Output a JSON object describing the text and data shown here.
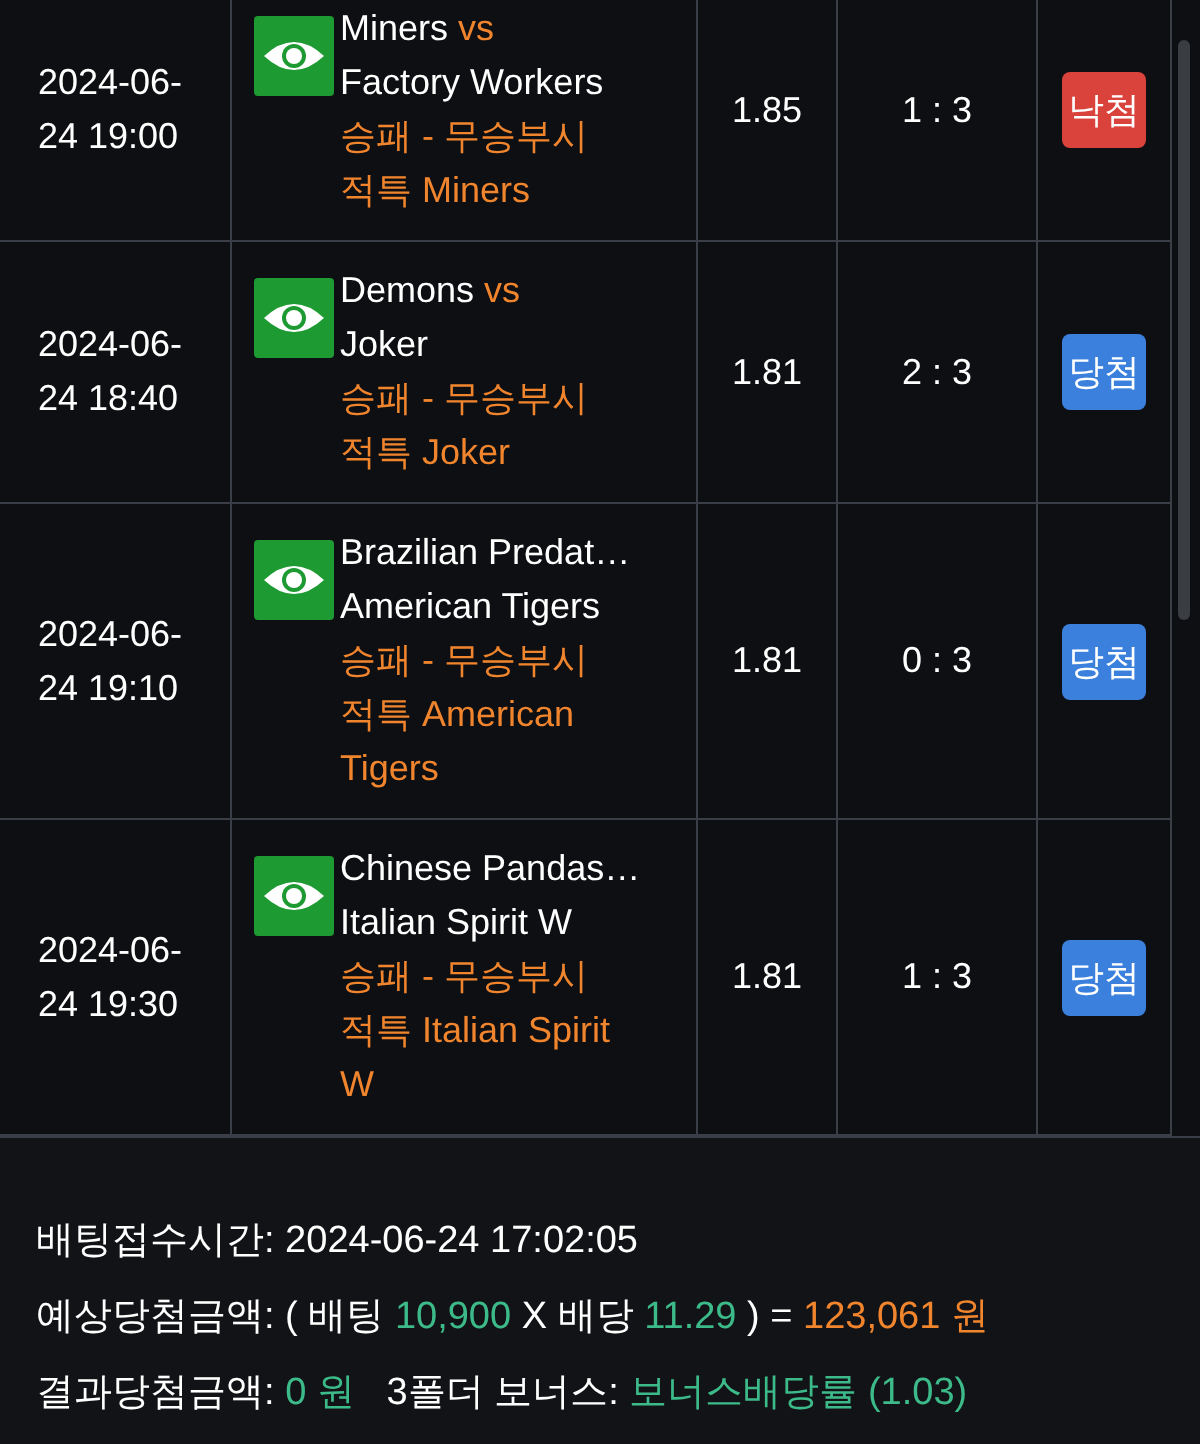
{
  "bets": [
    {
      "time": "2024-06-24 19:00",
      "home": "Miners",
      "vs": "vs",
      "away": "Factory Workers",
      "market": "승패 - 무승부시 적특 Miners",
      "odds": "1.85",
      "score": "1 : 3",
      "result": {
        "label": "낙첨",
        "kind": "lose"
      }
    },
    {
      "time": "2024-06-24 18:40",
      "home": "Demons",
      "vs": "vs",
      "away": "Joker",
      "market": "승패 - 무승부시 적특 Joker",
      "odds": "1.81",
      "score": "2 : 3",
      "result": {
        "label": "당첨",
        "kind": "win"
      }
    },
    {
      "time": "2024-06-24 19:10",
      "home": "Brazilian Predat…",
      "away": "American Tigers",
      "market": "승패 - 무승부시 적특 American Tigers",
      "odds": "1.81",
      "score": "0 : 3",
      "result": {
        "label": "당첨",
        "kind": "win"
      }
    },
    {
      "time": "2024-06-24 19:30",
      "home": "Chinese Pandas…",
      "away": "Italian Spirit W",
      "market": "승패 - 무승부시 적특 Italian Spirit W",
      "odds": "1.81",
      "score": "1 : 3",
      "result": {
        "label": "당첨",
        "kind": "win"
      }
    }
  ],
  "summary": [
    {
      "parts": [
        {
          "text": "배팅접수시간: 2024-06-24 17:02:05",
          "color": "#ffffff"
        }
      ]
    },
    {
      "parts": [
        {
          "text": "예상당첨금액: ( 배팅 ",
          "color": "#ffffff"
        },
        {
          "text": "10,900",
          "color": "#3dba8a"
        },
        {
          "text": " X 배당 ",
          "color": "#ffffff"
        },
        {
          "text": "11.29",
          "color": "#3dba8a"
        },
        {
          "text": " ) = ",
          "color": "#ffffff"
        },
        {
          "text": "123,061 원",
          "color": "#f0852e"
        }
      ]
    },
    {
      "parts": [
        {
          "text": "결과당첨금액: ",
          "color": "#ffffff"
        },
        {
          "text": "0 원",
          "color": "#3dba8a"
        },
        {
          "text": "   3폴더 보너스: ",
          "color": "#ffffff"
        },
        {
          "text": "보너스배당률 (1.03)",
          "color": "#3dba8a"
        }
      ]
    }
  ]
}
